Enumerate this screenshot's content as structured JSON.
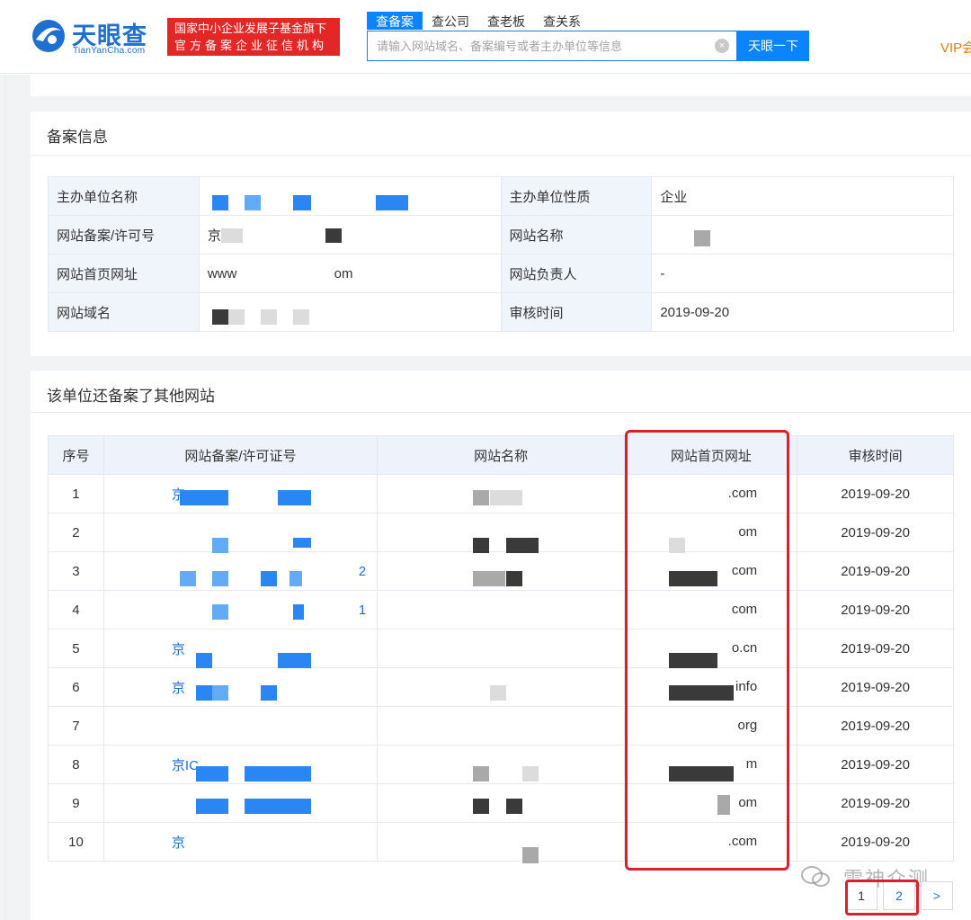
{
  "header": {
    "logo_cn": "天眼查",
    "logo_en": "TianYanCha.com",
    "badge_line1": "国家中小企业发展子基金旗下",
    "badge_line2": "官方备案企业征信机构",
    "tabs": [
      "查备案",
      "查公司",
      "查老板",
      "查关系"
    ],
    "search_placeholder": "请输入网站域名、备案编号或者主办单位等信息",
    "search_button": "天眼一下",
    "vip": "VIP会"
  },
  "record": {
    "title": "备案信息",
    "rows": [
      {
        "k1": "主办单位名称",
        "v1": "",
        "k2": "主办单位性质",
        "v2": "企业"
      },
      {
        "k1": "网站备案/许可号",
        "v1": "京",
        "k2": "网站名称",
        "v2": ""
      },
      {
        "k1": "网站首页网址",
        "v1": "www",
        "v1b": "om",
        "k2": "网站负责人",
        "v2": "-"
      },
      {
        "k1": "网站域名",
        "v1": "",
        "k2": "审核时间",
        "v2": "2019-09-20"
      }
    ]
  },
  "others": {
    "title": "该单位还备案了其他网站",
    "columns": [
      "序号",
      "网站备案/许可证号",
      "网站名称",
      "网站首页网址",
      "审核时间"
    ],
    "rows": [
      {
        "no": "1",
        "lic": "京",
        "url": ".com",
        "date": "2019-09-20"
      },
      {
        "no": "2",
        "lic": "",
        "url": "om",
        "date": "2019-09-20"
      },
      {
        "no": "3",
        "lic": "2",
        "url": "com",
        "date": "2019-09-20"
      },
      {
        "no": "4",
        "lic": "1",
        "url": "com",
        "date": "2019-09-20"
      },
      {
        "no": "5",
        "lic": "京",
        "url": "o.cn",
        "date": "2019-09-20"
      },
      {
        "no": "6",
        "lic": "京",
        "url": "info",
        "date": "2019-09-20"
      },
      {
        "no": "7",
        "lic": "",
        "url": "org",
        "date": "2019-09-20"
      },
      {
        "no": "8",
        "lic": "京IC",
        "url": "m",
        "date": "2019-09-20"
      },
      {
        "no": "9",
        "lic": "",
        "url": "om",
        "date": "2019-09-20"
      },
      {
        "no": "10",
        "lic": "京",
        "url": ".com",
        "date": "2019-09-20"
      }
    ]
  },
  "pager": {
    "pages": [
      "1",
      "2"
    ],
    "next": ">"
  },
  "watermark": "雷神众测",
  "colors": {
    "brand": "#0a84ff",
    "badge": "#e32727",
    "highlight": "#d9202c",
    "vip": "#ef7d00"
  }
}
